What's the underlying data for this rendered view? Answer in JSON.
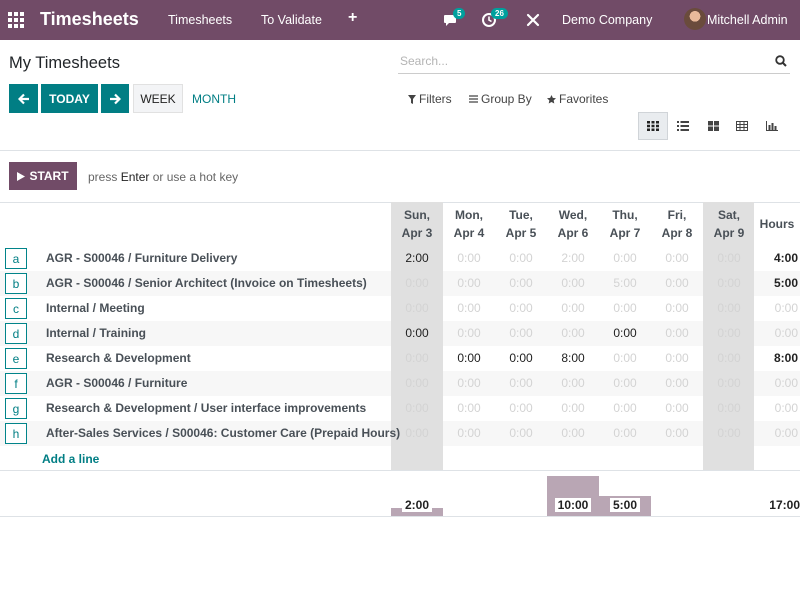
{
  "navbar": {
    "app_title": "Timesheets",
    "menu": [
      "Timesheets",
      "To Validate"
    ],
    "plus": "+",
    "messages_count": "5",
    "activities_count": "26",
    "company": "Demo Company",
    "user": "Mitchell Admin"
  },
  "control": {
    "title": "My Timesheets",
    "search_placeholder": "Search...",
    "today": "TODAY",
    "week": "WEEK",
    "month": "MONTH",
    "filters": "Filters",
    "group_by": "Group By",
    "favorites": "Favorites",
    "views": [
      "grid-view-icon",
      "list-view-icon",
      "kanban-view-icon",
      "pivot-view-icon",
      "graph-view-icon"
    ],
    "active_view": "grid-view-icon"
  },
  "timer": {
    "start": "START",
    "hint_press": "press",
    "hint_enter": "Enter",
    "hint_or": "or use a",
    "hint_hotkey": "hot key"
  },
  "grid": {
    "days": [
      {
        "name": "Sun,",
        "date": "Apr 3",
        "weekend": true
      },
      {
        "name": "Mon,",
        "date": "Apr 4",
        "weekend": false
      },
      {
        "name": "Tue,",
        "date": "Apr 5",
        "weekend": false
      },
      {
        "name": "Wed,",
        "date": "Apr 6",
        "weekend": false
      },
      {
        "name": "Thu,",
        "date": "Apr 7",
        "weekend": false
      },
      {
        "name": "Fri,",
        "date": "Apr 8",
        "weekend": false
      },
      {
        "name": "Sat,",
        "date": "Apr 9",
        "weekend": true
      }
    ],
    "total_header": "Hours",
    "rows": [
      {
        "hotkey": "a",
        "label": "AGR - S00046 / Furniture Delivery",
        "cells": [
          "2:00",
          "0:00",
          "0:00",
          "2:00",
          "0:00",
          "0:00",
          "0:00"
        ],
        "total": "4:00"
      },
      {
        "hotkey": "b",
        "label": "AGR - S00046 / Senior Architect (Invoice on Timesheets)",
        "cells": [
          "0:00",
          "0:00",
          "0:00",
          "0:00",
          "5:00",
          "0:00",
          "0:00"
        ],
        "total": "5:00"
      },
      {
        "hotkey": "c",
        "label": "Internal / Meeting",
        "cells": [
          "0:00",
          "0:00",
          "0:00",
          "0:00",
          "0:00",
          "0:00",
          "0:00"
        ],
        "total": "0:00"
      },
      {
        "hotkey": "d",
        "label": "Internal / Training",
        "cells": [
          "0:00",
          "0:00",
          "0:00",
          "0:00",
          "0:00",
          "0:00",
          "0:00"
        ],
        "total": "0:00"
      },
      {
        "hotkey": "e",
        "label": "Research & Development",
        "cells": [
          "0:00",
          "0:00",
          "0:00",
          "8:00",
          "0:00",
          "0:00",
          "0:00"
        ],
        "total": "8:00"
      },
      {
        "hotkey": "f",
        "label": "AGR - S00046 / Furniture",
        "cells": [
          "0:00",
          "0:00",
          "0:00",
          "0:00",
          "0:00",
          "0:00",
          "0:00"
        ],
        "total": "0:00"
      },
      {
        "hotkey": "g",
        "label": "Research & Development / User interface improvements",
        "cells": [
          "0:00",
          "0:00",
          "0:00",
          "0:00",
          "0:00",
          "0:00",
          "0:00"
        ],
        "total": "0:00"
      },
      {
        "hotkey": "h",
        "label": "After-Sales Services / S00046: Customer Care (Prepaid Hours)",
        "cells": [
          "0:00",
          "0:00",
          "0:00",
          "0:00",
          "0:00",
          "0:00",
          "0:00"
        ],
        "total": "0:00"
      }
    ],
    "emphasized_cells": [
      [
        0,
        0
      ],
      [
        0,
        3
      ],
      [
        1,
        4
      ],
      [
        2,
        4
      ],
      [
        3,
        4
      ],
      [
        4,
        3
      ]
    ],
    "add_line": "Add a line",
    "daily_totals": [
      "2:00",
      "0:00",
      "0:00",
      "10:00",
      "5:00",
      "0:00",
      "0:00"
    ],
    "daily_hours": [
      2,
      0,
      0,
      10,
      5,
      0,
      0
    ],
    "grand_total": "17:00"
  }
}
